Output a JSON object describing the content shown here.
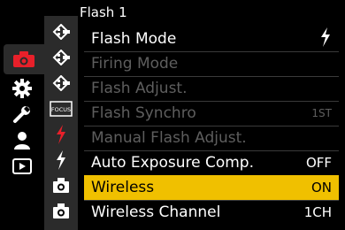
{
  "header": {
    "title": "Flash 1"
  },
  "main_tabs": [
    {
      "icon": "camera-icon",
      "active": true
    },
    {
      "icon": "gear-icon",
      "active": false
    },
    {
      "icon": "wrench-icon",
      "active": false
    },
    {
      "icon": "person-icon",
      "active": false
    },
    {
      "icon": "playback-icon",
      "active": false
    }
  ],
  "sub_tabs": [
    {
      "icon": "image-quality-icon"
    },
    {
      "icon": "image-quality-icon"
    },
    {
      "icon": "image-quality-icon"
    },
    {
      "icon": "focus-icon",
      "label": "FOCUS"
    },
    {
      "icon": "flash-icon",
      "active": true
    },
    {
      "icon": "flash-icon"
    },
    {
      "icon": "camera-settings-icon"
    },
    {
      "icon": "camera-settings-icon"
    }
  ],
  "menu": {
    "items": [
      {
        "label": "Flash Mode",
        "value": "",
        "value_icon": "flash-forced-icon",
        "enabled": true,
        "selected": false
      },
      {
        "label": "Firing Mode",
        "value": "",
        "enabled": false,
        "selected": false
      },
      {
        "label": "Flash Adjust.",
        "value": "",
        "enabled": false,
        "selected": false
      },
      {
        "label": "Flash Synchro",
        "value": "1ST",
        "enabled": false,
        "selected": false
      },
      {
        "label": "Manual Flash Adjust.",
        "value": "",
        "enabled": false,
        "selected": false
      },
      {
        "label": "Auto Exposure Comp.",
        "value": "OFF",
        "enabled": true,
        "selected": false
      },
      {
        "label": "Wireless",
        "value": "ON",
        "enabled": true,
        "selected": true
      },
      {
        "label": "Wireless Channel",
        "value": "1CH",
        "enabled": true,
        "selected": false
      }
    ]
  },
  "colors": {
    "highlight": "#f0c000",
    "active_tab": "#e8202a",
    "disabled_text": "#5e5e5e",
    "tab_background": "#2b2b2b"
  }
}
